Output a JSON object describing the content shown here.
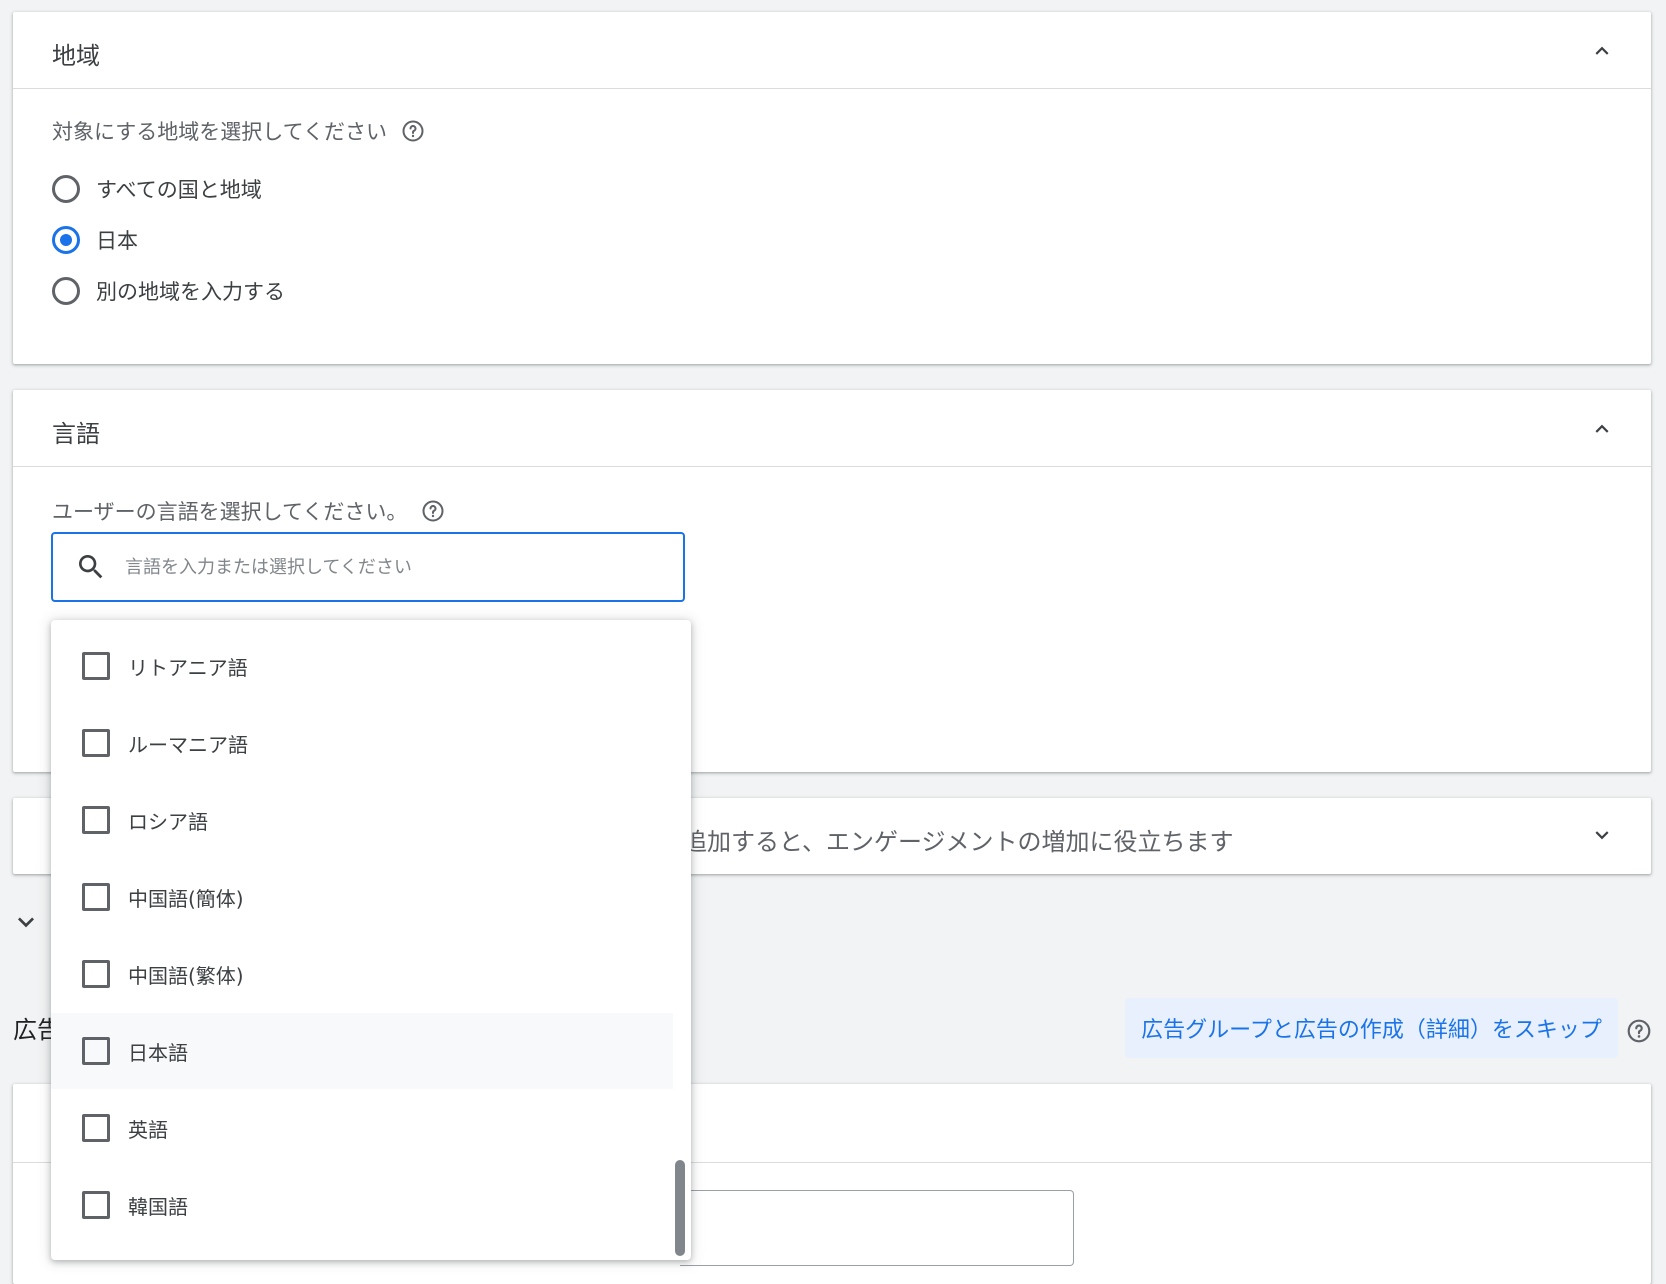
{
  "region_section": {
    "title": "地域",
    "prompt": "対象にする地域を選択してください",
    "options": [
      {
        "label": "すべての国と地域",
        "selected": false
      },
      {
        "label": "日本",
        "selected": true
      },
      {
        "label": "別の地域を入力する",
        "selected": false
      }
    ]
  },
  "language_section": {
    "title": "言語",
    "prompt": "ユーザーの言語を選択してください。",
    "search_placeholder": "言語を入力または選択してください",
    "search_value": ""
  },
  "language_dropdown": {
    "options": [
      {
        "label": "リトアニア語",
        "checked": false
      },
      {
        "label": "ルーマニア語",
        "checked": false
      },
      {
        "label": "ロシア語",
        "checked": false
      },
      {
        "label": "中国語(簡体)",
        "checked": false
      },
      {
        "label": "中国語(繁体)",
        "checked": false
      },
      {
        "label": "日本語",
        "checked": false,
        "hovered": true
      },
      {
        "label": "英語",
        "checked": false
      },
      {
        "label": "韓国語",
        "checked": false
      }
    ]
  },
  "collapsed_section": {
    "partial_text": "追加すると、エンゲージメントの増加に役立ちます"
  },
  "ad_group_section": {
    "partial_heading": "広告",
    "skip_button_label": "広告グループと広告の作成（詳細）をスキップ"
  },
  "colors": {
    "accent": "#1a73e8",
    "background": "#f1f3f4",
    "card": "#ffffff",
    "skip_button_bg": "#e8f0fe"
  }
}
